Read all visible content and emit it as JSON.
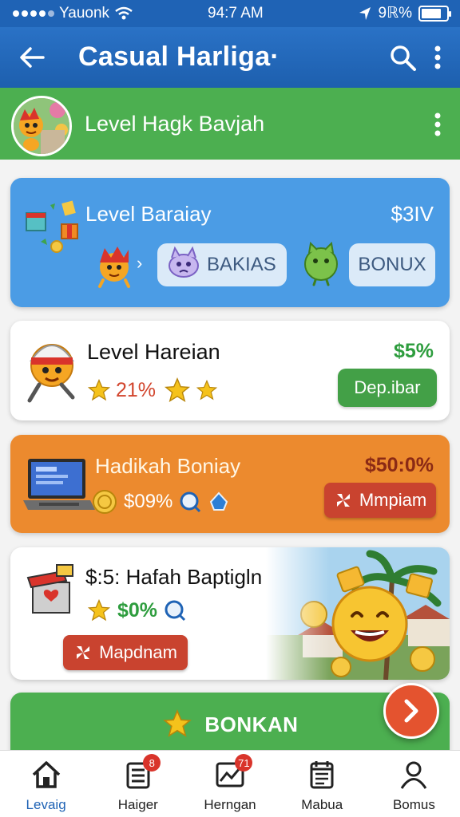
{
  "status_bar": {
    "carrier": "Yauonk",
    "time": "94:7 AM",
    "battery": "9ℝ%"
  },
  "app_bar": {
    "title": "Casual Harliga·"
  },
  "level_header": {
    "title": "Level Hagk Bavjah"
  },
  "cards": [
    {
      "title": "Level Baraiay",
      "price": "$3IV",
      "chips": [
        "BAKIAS",
        "BONUX"
      ],
      "arrow": "›"
    },
    {
      "title": "Level Hareian",
      "price": "$5%",
      "stat": "21%",
      "button": "Dep.ibar"
    },
    {
      "title": "Hadikah Boniay",
      "price": "$50:0%",
      "stat": "$09%",
      "button": "Mmpiam"
    },
    {
      "title": "$:5: Hafah Baptigln",
      "stat": "$0%",
      "button": "Mapdnam"
    }
  ],
  "cta": {
    "label": "BONKAN"
  },
  "bottom_nav": [
    {
      "label": "Levaig",
      "icon": "home-icon",
      "active": true
    },
    {
      "label": "Haiger",
      "icon": "list-icon",
      "badge": "8"
    },
    {
      "label": "Herngan",
      "icon": "chart-icon",
      "badge": "71"
    },
    {
      "label": "Mabua",
      "icon": "calendar-icon"
    },
    {
      "label": "Bomus",
      "icon": "profile-icon"
    }
  ],
  "colors": {
    "primary": "#1f63b5",
    "green": "#4caf50",
    "card_blue": "#4b9ce5",
    "card_orange": "#ec8a2e",
    "red_button": "#c9432f"
  }
}
